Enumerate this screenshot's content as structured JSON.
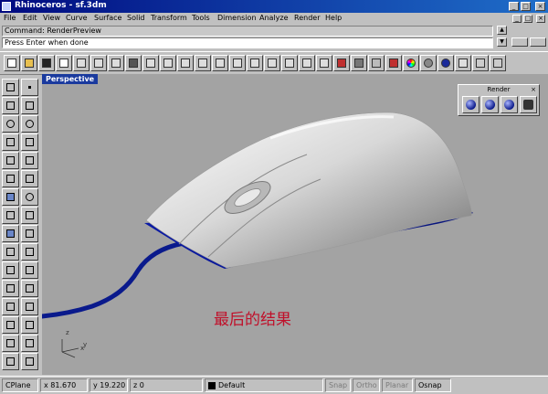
{
  "window": {
    "app_name": "Rhinoceros",
    "file_name": "sf.3dm",
    "minimize": "_",
    "maximize": "□",
    "close": "×"
  },
  "menu": [
    "File",
    "Edit",
    "View",
    "Curve",
    "Surface",
    "Solid",
    "Transform",
    "Tools",
    "Dimension",
    "Analyze",
    "Render",
    "Help"
  ],
  "mdi_controls": [
    "_",
    "□",
    "×"
  ],
  "command_history": "Command: RenderPreview",
  "command_prompt": "Press Enter when done",
  "toolbar_icons": [
    "new-icon",
    "open-icon",
    "save-icon",
    "print-icon",
    "cut-icon",
    "copy-icon",
    "paste-icon",
    "undo-icon",
    "pan-hand-icon",
    "rotate-view-icon",
    "zoom-icon",
    "zoom-window-icon",
    "zoom-dynamic-icon",
    "zoom-extents-icon",
    "zoom-selected-icon",
    "undo-view-icon",
    "four-viewports-icon",
    "cplane-icon",
    "grid-icon",
    "snap-icon",
    "layers-icon",
    "osnap-icon",
    "material-icon",
    "color-wheel-icon",
    "shaded-sphere-icon",
    "render-sphere-icon",
    "light-icon",
    "settings-icon",
    "help-icon"
  ],
  "left_tools": [
    "select-icon",
    "point-icon",
    "polyline-icon",
    "curve-icon",
    "circle-icon",
    "arc-icon",
    "ellipse-icon",
    "rectangle-icon",
    "polygon-icon",
    "fillet-curve-icon",
    "surface-corner-icon",
    "extrude-surface-icon",
    "box-icon",
    "sphere-icon",
    "cylinder-icon",
    "boolean-icon",
    "mesh-icon",
    "transform-icon",
    "join-icon",
    "explode-icon",
    "trim-icon",
    "split-icon",
    "move-icon",
    "copy-object-icon",
    "rotate-icon",
    "scale-icon",
    "text-icon",
    "dimension-icon",
    "array-icon",
    "curve-from-object-icon",
    "group-icon",
    "hide-icon"
  ],
  "viewport": {
    "name": "Perspective",
    "axis_label_x": "x",
    "axis_label_y": "y",
    "axis_label_z": "z"
  },
  "render_toolbar": {
    "title": "Render",
    "close": "×",
    "buttons": [
      "render-icon",
      "render-preview-icon",
      "render-settings-icon",
      "camera-icon"
    ]
  },
  "caption": "最后的结果",
  "status": {
    "cplane": "CPlane",
    "x": "x 81.670",
    "y": "y 19.220",
    "z": "z 0",
    "layer": "Default",
    "snap": "Snap",
    "ortho": "Ortho",
    "planar": "Planar",
    "osnap": "Osnap"
  },
  "colors": {
    "mouse_body": "#d7d7d7",
    "mouse_base": "#0a1c9e",
    "cable": "#0a1a8c",
    "viewport_bg": "#a3a3a3",
    "caption": "#c0102a",
    "title_bar": "#000a80"
  }
}
